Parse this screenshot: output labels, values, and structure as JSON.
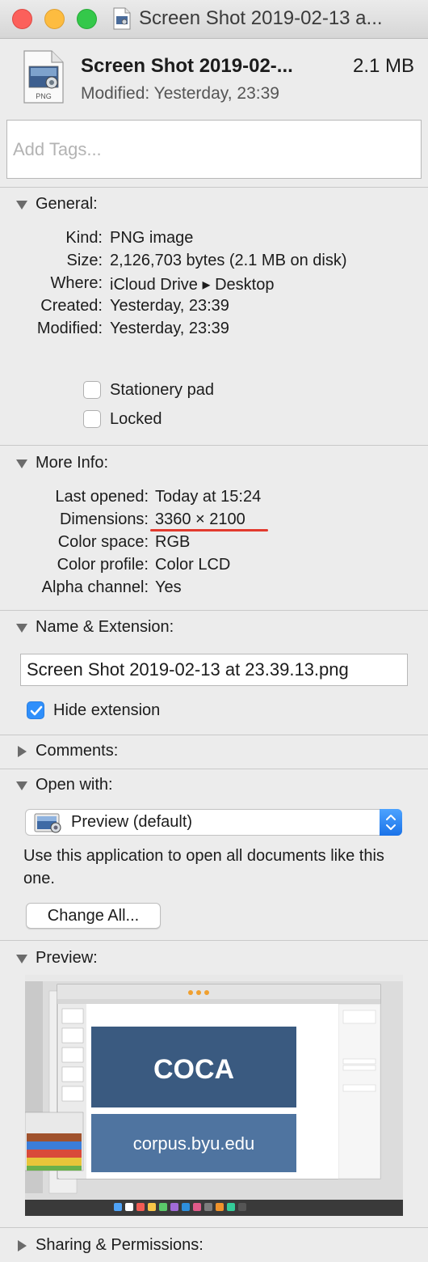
{
  "window": {
    "title": "Screen Shot 2019-02-13 a..."
  },
  "header": {
    "file_name": "Screen Shot 2019-02-...",
    "file_size": "2.1 MB",
    "modified": "Modified: Yesterday, 23:39",
    "file_type_badge": "PNG",
    "tags_placeholder": "Add Tags..."
  },
  "general": {
    "title": "General:",
    "rows": [
      {
        "label": "Kind:",
        "value": "PNG image"
      },
      {
        "label": "Size:",
        "value": "2,126,703 bytes (2.1 MB on disk)"
      },
      {
        "label": "Where:",
        "value": "iCloud Drive ▸ Desktop"
      },
      {
        "label": "Created:",
        "value": "Yesterday, 23:39"
      },
      {
        "label": "Modified:",
        "value": "Yesterday, 23:39"
      }
    ],
    "stationery_label": "Stationery pad",
    "stationery_checked": false,
    "locked_label": "Locked",
    "locked_checked": false
  },
  "more_info": {
    "title": "More Info:",
    "rows": [
      {
        "label": "Last opened:",
        "value": "Today at 15:24"
      },
      {
        "label": "Dimensions:",
        "value": "3360 × 2100"
      },
      {
        "label": "Color space:",
        "value": "RGB"
      },
      {
        "label": "Color profile:",
        "value": "Color LCD"
      },
      {
        "label": "Alpha channel:",
        "value": "Yes"
      }
    ]
  },
  "name_extension": {
    "title": "Name & Extension:",
    "value": "Screen Shot 2019-02-13 at 23.39.13.png",
    "hide_extension_label": "Hide extension",
    "hide_extension_checked": true
  },
  "comments": {
    "title": "Comments:"
  },
  "open_with": {
    "title": "Open with:",
    "selected": "Preview (default)",
    "help_text": "Use this application to open all documents like this one.",
    "change_all_label": "Change All..."
  },
  "preview": {
    "title": "Preview:",
    "slide_text_1": "COCA",
    "slide_text_2": "corpus.byu.edu"
  },
  "sharing": {
    "title": "Sharing & Permissions:"
  },
  "colors": {
    "accent": "#2f8ffb",
    "highlight_underline": "#e23a2e",
    "slide_dark": "#3a5a80",
    "slide_light": "#4f74a0"
  }
}
